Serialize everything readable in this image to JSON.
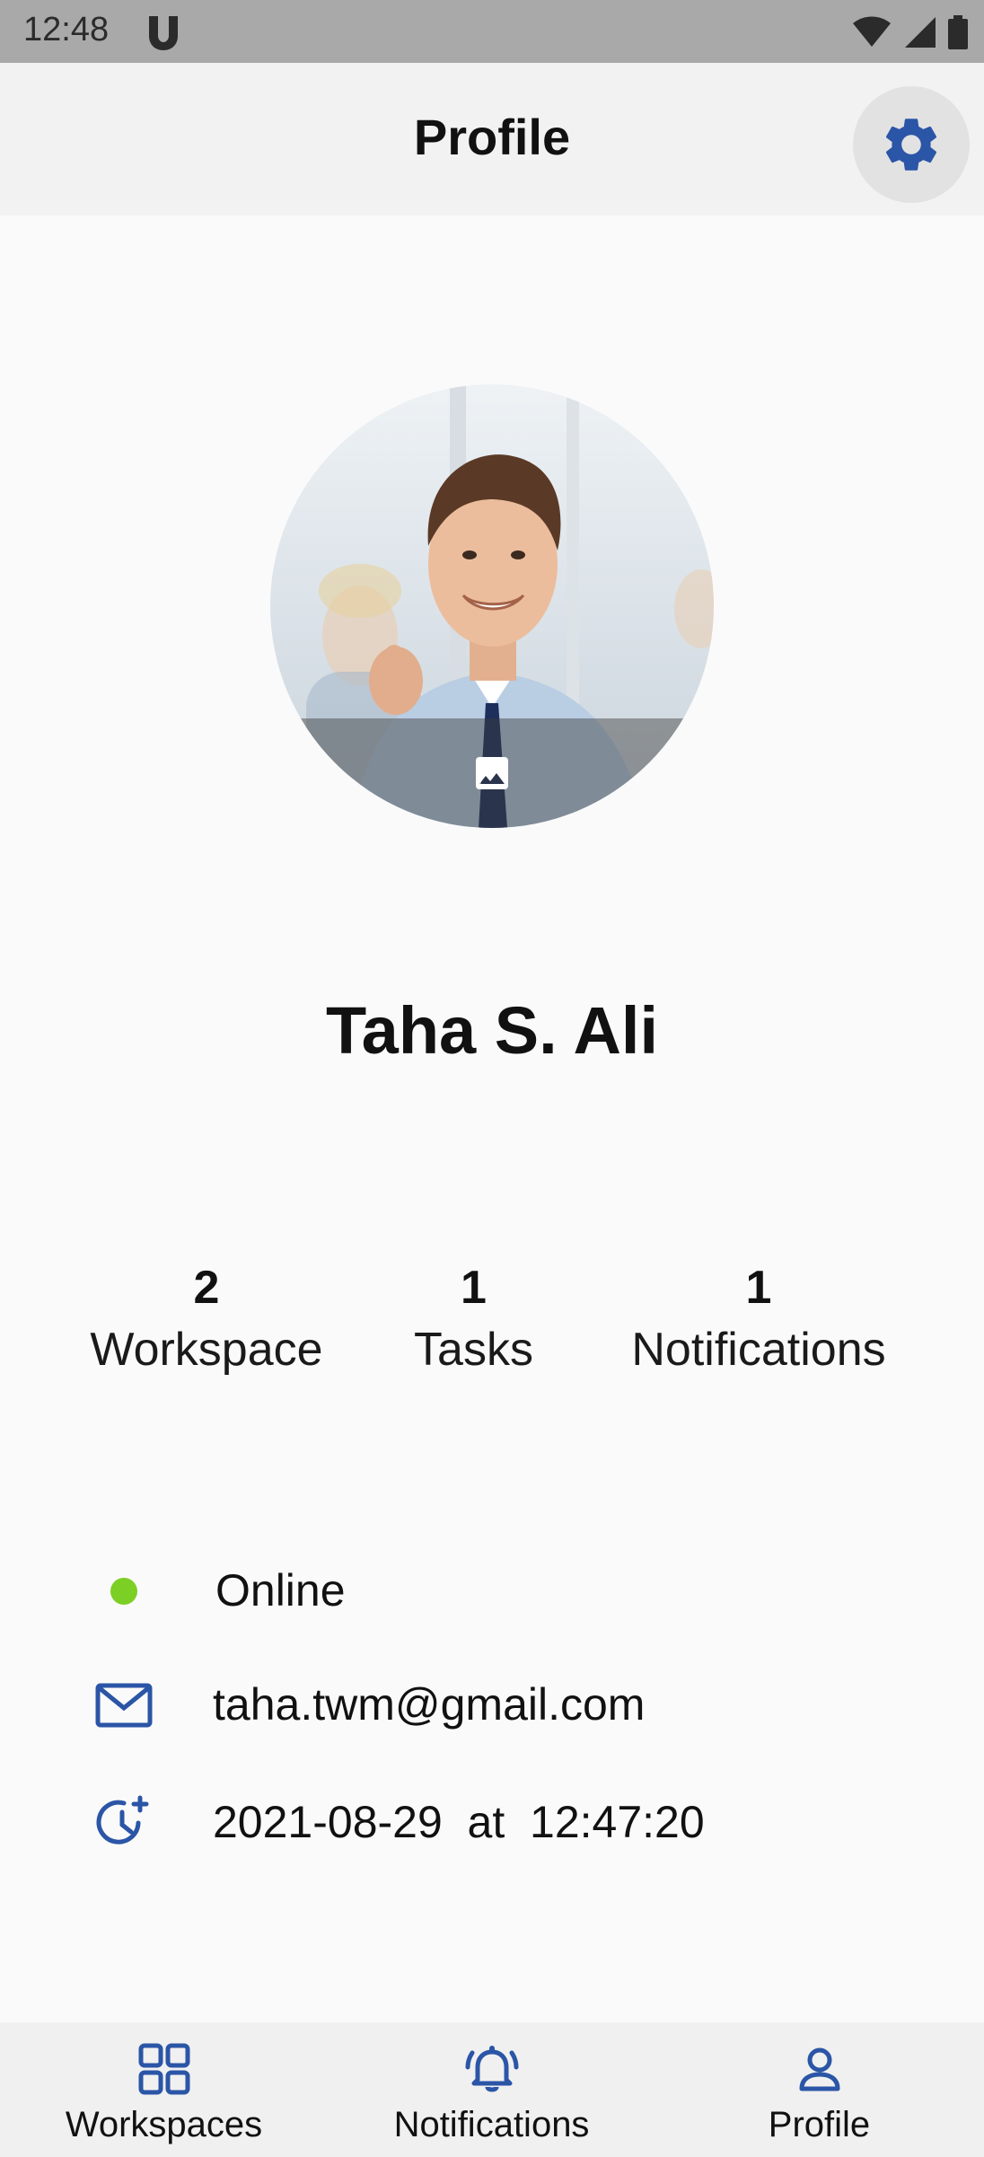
{
  "status_bar": {
    "time": "12:48",
    "icons": [
      "app-u-icon",
      "wifi-icon",
      "cell-signal-icon",
      "battery-icon"
    ]
  },
  "header": {
    "title": "Profile",
    "settings_icon": "gear-icon"
  },
  "profile": {
    "name": "Taha S. Ali",
    "avatar_action_icon": "image-icon"
  },
  "stats": [
    {
      "value": "2",
      "label": "Workspace"
    },
    {
      "value": "1",
      "label": "Tasks"
    },
    {
      "value": "1",
      "label": "Notifications"
    }
  ],
  "info": {
    "status": "Online",
    "email": "taha.twm@gmail.com",
    "last_seen": "2021-08-29  at  12:47:20"
  },
  "bottom_nav": [
    {
      "label": "Workspaces",
      "icon": "grid-icon"
    },
    {
      "label": "Notifications",
      "icon": "bell-icon"
    },
    {
      "label": "Profile",
      "icon": "person-icon"
    }
  ],
  "colors": {
    "accent": "#2b55a6",
    "online": "#7ccf24",
    "header_bg": "#f2f2f2",
    "nav_bg": "#f0f0f0"
  }
}
